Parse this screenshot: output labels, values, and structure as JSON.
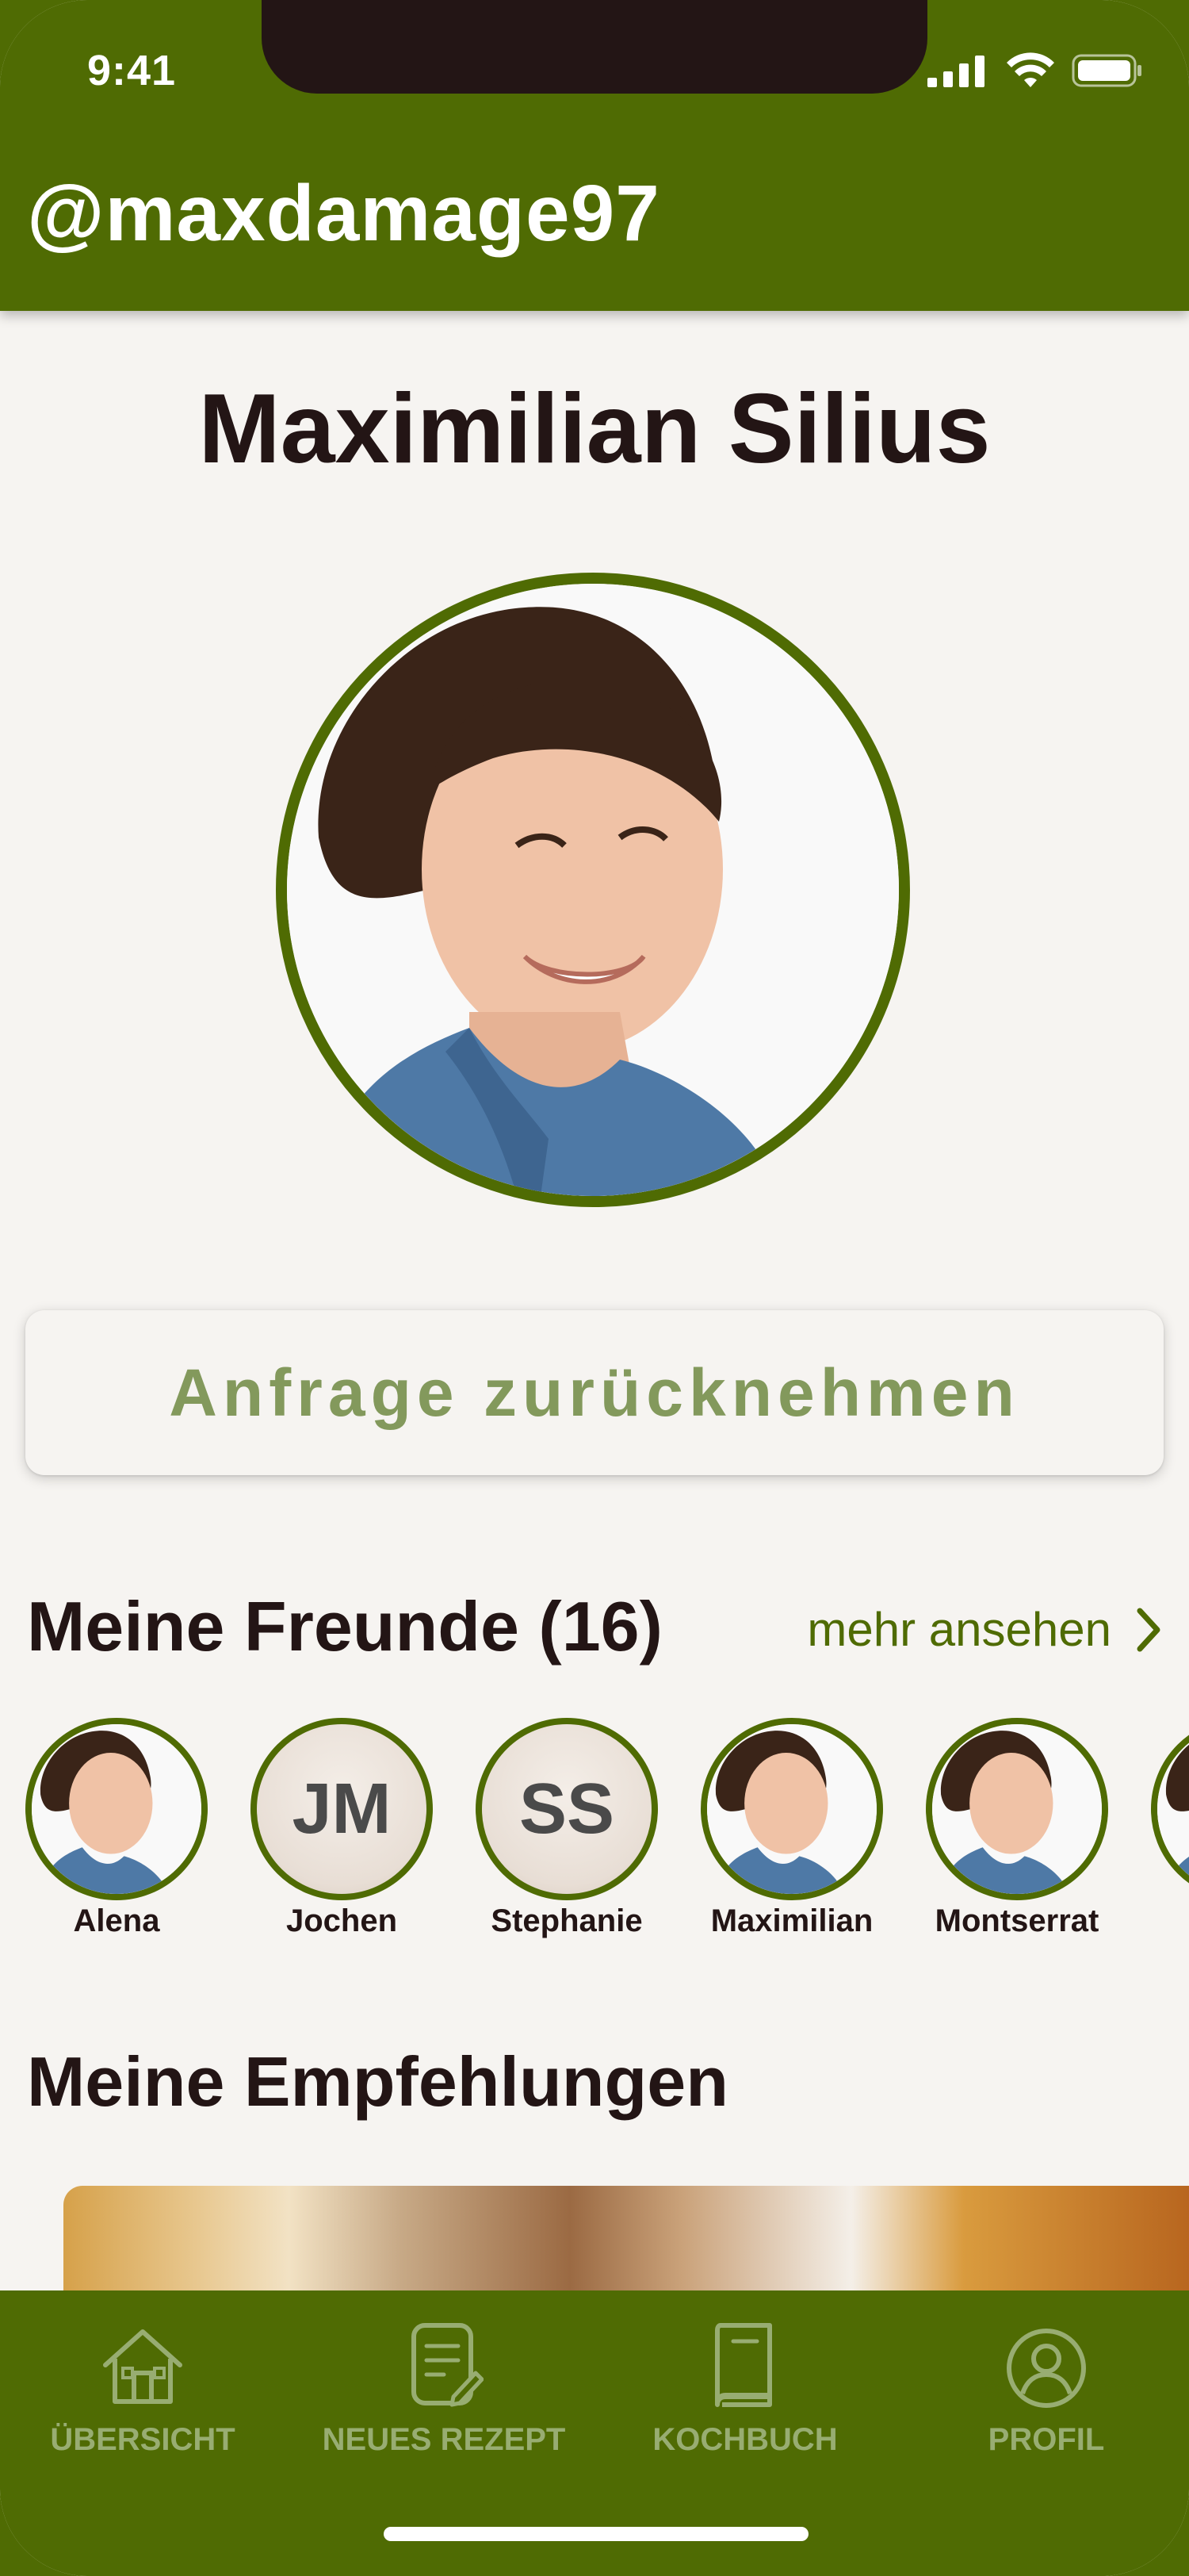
{
  "status_bar": {
    "time": "9:41"
  },
  "header": {
    "handle": "@maxdamage97"
  },
  "profile": {
    "name": "Maximilian Silius",
    "request_button_label": "Anfrage zurücknehmen"
  },
  "friends_section": {
    "title": "Meine Freunde (16)",
    "more_label": "mehr ansehen",
    "friends": [
      {
        "name": "Alena",
        "type": "photo"
      },
      {
        "name": "Jochen",
        "type": "initials",
        "initials": "JM"
      },
      {
        "name": "Stephanie",
        "type": "initials",
        "initials": "SS"
      },
      {
        "name": "Maximilian",
        "type": "photo"
      },
      {
        "name": "Montserrat",
        "type": "photo"
      }
    ]
  },
  "recommendations_section": {
    "title": "Meine Empfehlungen"
  },
  "tab_bar": {
    "tabs": [
      {
        "label": "ÜBERSICHT",
        "icon": "house-icon"
      },
      {
        "label": "NEUES REZEPT",
        "icon": "note-edit-icon"
      },
      {
        "label": "KOCHBUCH",
        "icon": "book-icon"
      },
      {
        "label": "PROFIL",
        "icon": "user-circle-icon"
      }
    ]
  },
  "colors": {
    "brand_green": "#4f6b03",
    "background": "#f6f4f1",
    "text_dark": "#231515",
    "button_text": "#83995c",
    "tab_inactive": "#98ad72"
  }
}
